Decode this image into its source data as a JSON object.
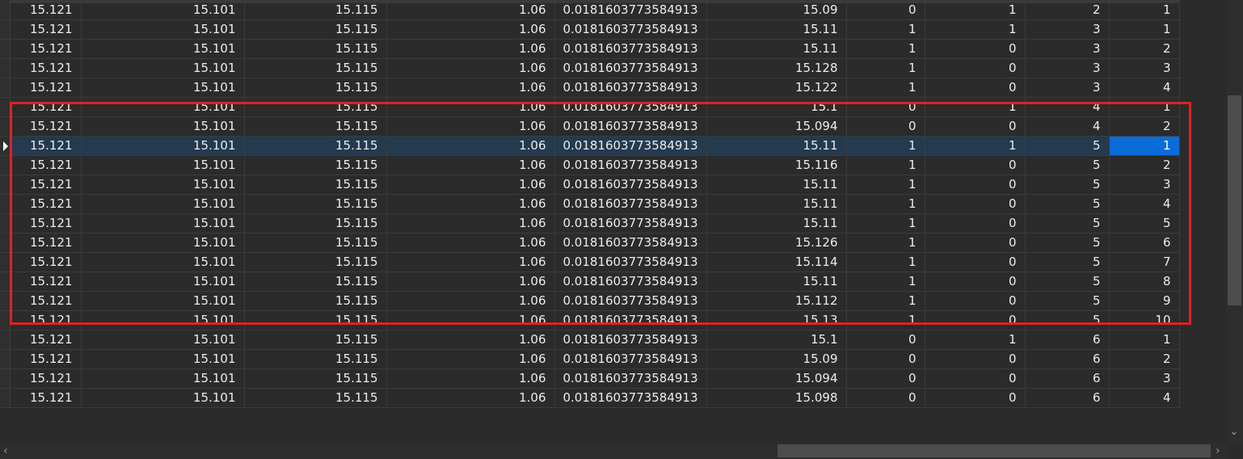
{
  "grid": {
    "selected_row_index": 7,
    "current_cell_column": 11,
    "rows": [
      [
        "15.121",
        "15.101",
        "15.115",
        "1.06",
        "0.0181603773584913",
        "15.09",
        "0",
        "1",
        "2",
        "1"
      ],
      [
        "15.121",
        "15.101",
        "15.115",
        "1.06",
        "0.0181603773584913",
        "15.11",
        "1",
        "1",
        "3",
        "1"
      ],
      [
        "15.121",
        "15.101",
        "15.115",
        "1.06",
        "0.0181603773584913",
        "15.11",
        "1",
        "0",
        "3",
        "2"
      ],
      [
        "15.121",
        "15.101",
        "15.115",
        "1.06",
        "0.0181603773584913",
        "15.128",
        "1",
        "0",
        "3",
        "3"
      ],
      [
        "15.121",
        "15.101",
        "15.115",
        "1.06",
        "0.0181603773584913",
        "15.122",
        "1",
        "0",
        "3",
        "4"
      ],
      [
        "15.121",
        "15.101",
        "15.115",
        "1.06",
        "0.0181603773584913",
        "15.1",
        "0",
        "1",
        "4",
        "1"
      ],
      [
        "15.121",
        "15.101",
        "15.115",
        "1.06",
        "0.0181603773584913",
        "15.094",
        "0",
        "0",
        "4",
        "2"
      ],
      [
        "15.121",
        "15.101",
        "15.115",
        "1.06",
        "0.0181603773584913",
        "15.11",
        "1",
        "1",
        "5",
        "1"
      ],
      [
        "15.121",
        "15.101",
        "15.115",
        "1.06",
        "0.0181603773584913",
        "15.116",
        "1",
        "0",
        "5",
        "2"
      ],
      [
        "15.121",
        "15.101",
        "15.115",
        "1.06",
        "0.0181603773584913",
        "15.11",
        "1",
        "0",
        "5",
        "3"
      ],
      [
        "15.121",
        "15.101",
        "15.115",
        "1.06",
        "0.0181603773584913",
        "15.11",
        "1",
        "0",
        "5",
        "4"
      ],
      [
        "15.121",
        "15.101",
        "15.115",
        "1.06",
        "0.0181603773584913",
        "15.11",
        "1",
        "0",
        "5",
        "5"
      ],
      [
        "15.121",
        "15.101",
        "15.115",
        "1.06",
        "0.0181603773584913",
        "15.126",
        "1",
        "0",
        "5",
        "6"
      ],
      [
        "15.121",
        "15.101",
        "15.115",
        "1.06",
        "0.0181603773584913",
        "15.114",
        "1",
        "0",
        "5",
        "7"
      ],
      [
        "15.121",
        "15.101",
        "15.115",
        "1.06",
        "0.0181603773584913",
        "15.11",
        "1",
        "0",
        "5",
        "8"
      ],
      [
        "15.121",
        "15.101",
        "15.115",
        "1.06",
        "0.0181603773584913",
        "15.112",
        "1",
        "0",
        "5",
        "9"
      ],
      [
        "15.121",
        "15.101",
        "15.115",
        "1.06",
        "0.0181603773584913",
        "15.13",
        "1",
        "0",
        "5",
        "10"
      ],
      [
        "15.121",
        "15.101",
        "15.115",
        "1.06",
        "0.0181603773584913",
        "15.1",
        "0",
        "1",
        "6",
        "1"
      ],
      [
        "15.121",
        "15.101",
        "15.115",
        "1.06",
        "0.0181603773584913",
        "15.09",
        "0",
        "0",
        "6",
        "2"
      ],
      [
        "15.121",
        "15.101",
        "15.115",
        "1.06",
        "0.0181603773584913",
        "15.094",
        "0",
        "0",
        "6",
        "3"
      ],
      [
        "15.121",
        "15.101",
        "15.115",
        "1.06",
        "0.0181603773584913",
        "15.098",
        "0",
        "0",
        "6",
        "4"
      ]
    ]
  },
  "highlight": {
    "first_row": 5,
    "last_row": 15,
    "color": "#e02222"
  },
  "colors": {
    "background": "#2b2b2b",
    "selected_row": "#233a4f",
    "current_cell": "#0a6cd6",
    "grid_line": "#3c3c3c"
  },
  "scrollbars": {
    "horizontal": {
      "left_arrow": "‹",
      "right_arrow": "›"
    },
    "vertical": {
      "down_arrow": "⌄"
    }
  }
}
